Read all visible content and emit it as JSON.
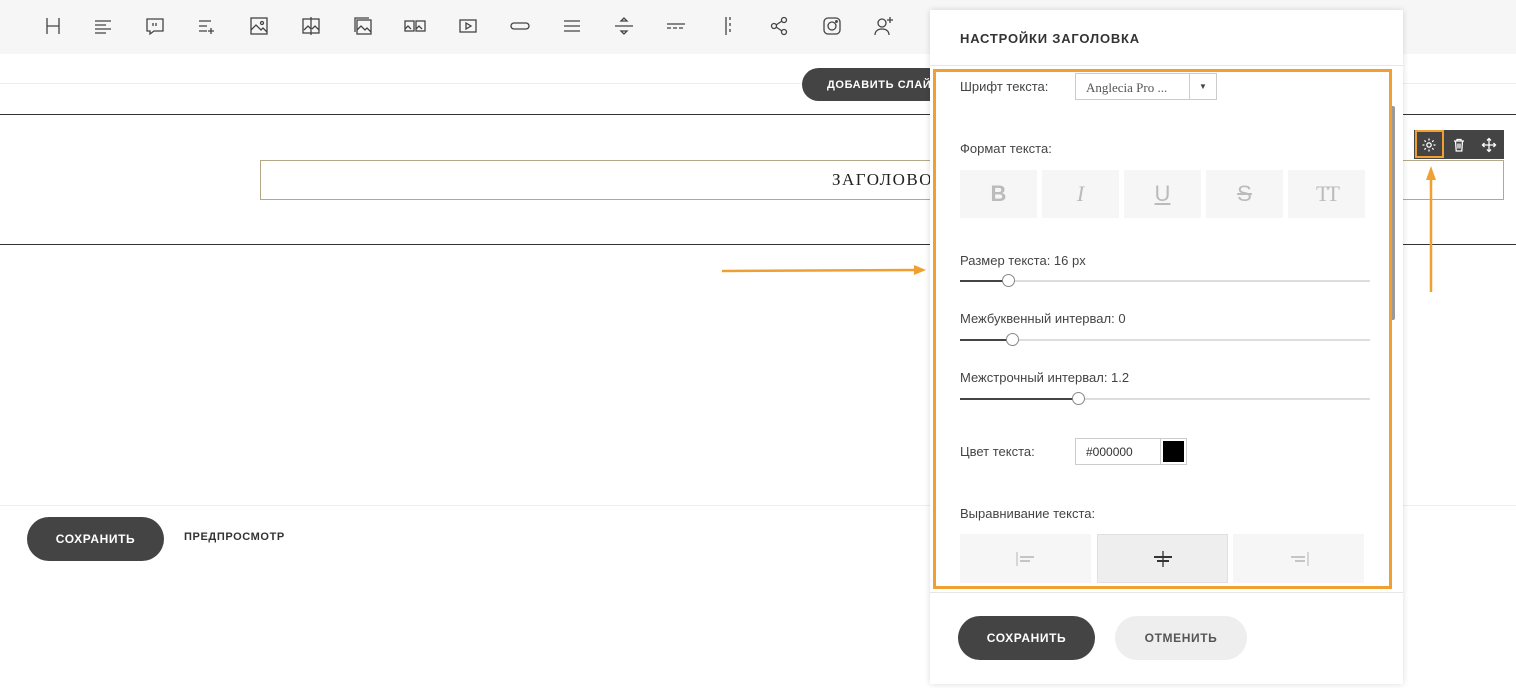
{
  "toolbar": {
    "tools": [
      {
        "icon": "heading-icon"
      },
      {
        "icon": "text-icon"
      },
      {
        "icon": "quote-icon"
      },
      {
        "icon": "list-add-icon"
      },
      {
        "icon": "image-icon"
      },
      {
        "icon": "image-compare-icon"
      },
      {
        "icon": "gallery-icon"
      },
      {
        "icon": "slider-icon"
      },
      {
        "icon": "video-icon"
      },
      {
        "icon": "button-icon"
      },
      {
        "icon": "menu-icon"
      },
      {
        "icon": "divider-icon"
      },
      {
        "icon": "dashed-divider-icon"
      },
      {
        "icon": "vertical-divider-icon"
      },
      {
        "icon": "share-icon"
      },
      {
        "icon": "instagram-icon"
      },
      {
        "icon": "user-add-icon"
      }
    ]
  },
  "canvas": {
    "add_slide_label": "ДОБАВИТЬ СЛАЙДЕР",
    "heading_text": "ЗАГОЛОВОК",
    "save_label": "СОХРАНИТЬ",
    "preview_label": "ПРЕДПРОСМОТР",
    "block_tools": [
      {
        "icon": "gear-icon"
      },
      {
        "icon": "trash-icon"
      },
      {
        "icon": "move-icon"
      }
    ]
  },
  "panel": {
    "title": "НАСТРОЙКИ ЗАГОЛОВКА",
    "font_label": "Шрифт текста:",
    "font_value": "Anglecia Pro ...",
    "format_label": "Формат текста:",
    "format_buttons": [
      {
        "label": "B",
        "icon": "bold-icon"
      },
      {
        "label": "I",
        "icon": "italic-icon"
      },
      {
        "label": "U",
        "icon": "underline-icon"
      },
      {
        "label": "S",
        "icon": "strikethrough-icon"
      },
      {
        "label": "TT",
        "icon": "uppercase-icon"
      }
    ],
    "size_label": "Размер текста: 16 px",
    "size_fraction": 0.12,
    "letter_spacing_label": "Межбуквенный интервал: 0",
    "letter_spacing_fraction": 0.13,
    "line_height_label": "Межстрочный интервал: 1.2",
    "line_height_fraction": 0.29,
    "color_label": "Цвет текста:",
    "color_value": "#000000",
    "align_label": "Выравнивание текста:",
    "align_options": [
      {
        "icon": "align-left-icon",
        "active": false
      },
      {
        "icon": "align-center-icon",
        "active": true
      },
      {
        "icon": "align-right-icon",
        "active": false
      }
    ],
    "save_label": "СОХРАНИТЬ",
    "cancel_label": "ОТМЕНИТЬ"
  },
  "colors": {
    "accent": "#f0a030",
    "dark": "#444444",
    "highlight_border": "#b5a888"
  }
}
